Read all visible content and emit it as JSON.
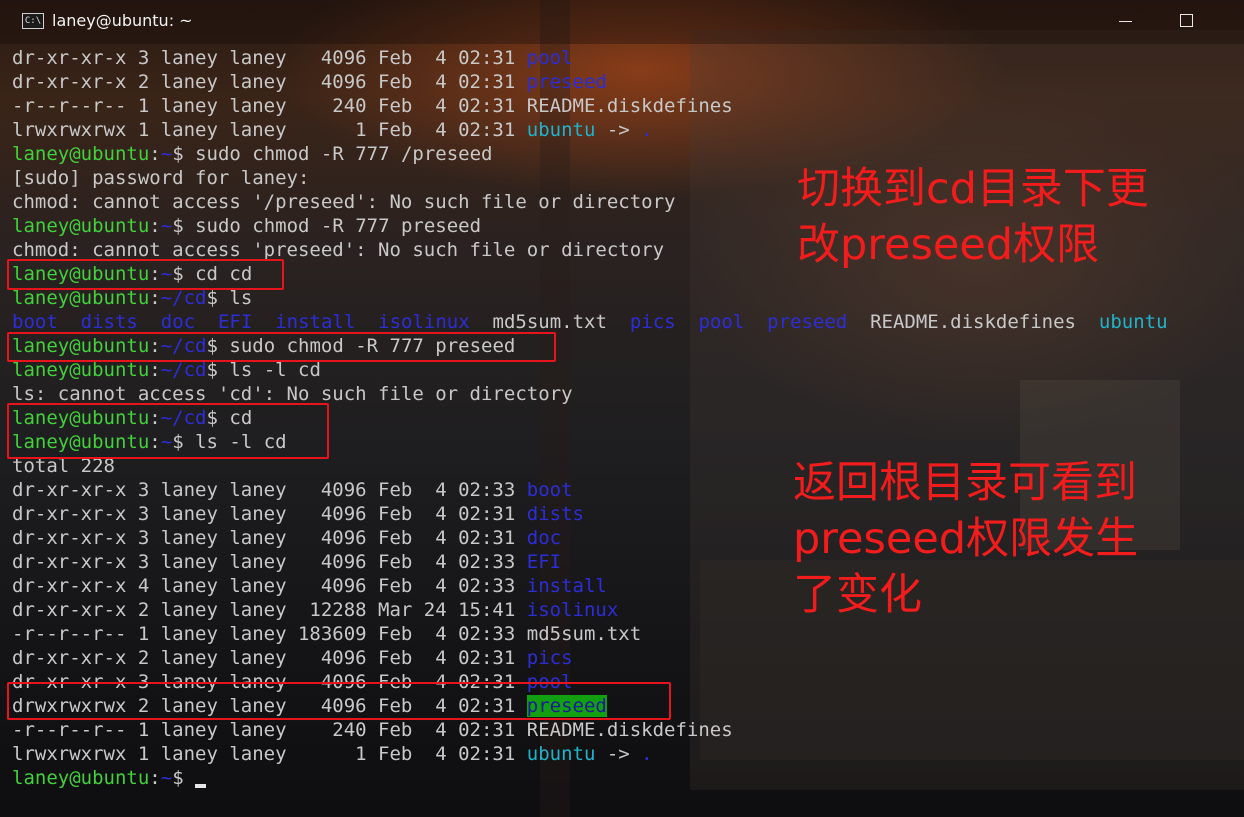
{
  "window": {
    "title": "laney@ubuntu: ~",
    "icon": "C:\\",
    "controls": [
      "minimize-icon",
      "maximize-icon"
    ]
  },
  "colors": {
    "prompt": "#41d13a",
    "directory": "#2d2dd8",
    "symlink": "#20b3cc",
    "highlight_bg": "#13a010",
    "annotation": "#f31c1c"
  },
  "terminal": {
    "lines": [
      {
        "name": "line-ls-pool",
        "segs": [
          [
            "dr-xr-xr-x 3 laney laney   4096 Feb  4 02:31 ",
            "c-gray"
          ],
          [
            "pool",
            "c-blue"
          ]
        ]
      },
      {
        "name": "line-ls-preseed",
        "segs": [
          [
            "dr-xr-xr-x 2 laney laney   4096 Feb  4 02:31 ",
            "c-gray"
          ],
          [
            "preseed",
            "c-blue"
          ]
        ]
      },
      {
        "name": "line-ls-readme",
        "segs": [
          [
            "-r--r--r-- 1 laney laney    240 Feb  4 02:31 README.diskdefines",
            "c-gray"
          ]
        ]
      },
      {
        "name": "line-ls-ubuntu",
        "segs": [
          [
            "lrwxrwxrwx 1 laney laney      1 Feb  4 02:31 ",
            "c-gray"
          ],
          [
            "ubuntu",
            "c-cyan"
          ],
          [
            " -> ",
            "c-gray"
          ],
          [
            ".",
            "c-blue"
          ]
        ]
      },
      {
        "name": "line-cmd-chmod-root",
        "segs": [
          [
            "laney@ubuntu",
            "c-green"
          ],
          [
            ":",
            "c-gray"
          ],
          [
            "~",
            "c-blue"
          ],
          [
            "$ sudo chmod -R 777 /preseed",
            "c-gray"
          ]
        ]
      },
      {
        "name": "line-sudo-password",
        "segs": [
          [
            "[sudo] password for laney:",
            "c-gray"
          ]
        ]
      },
      {
        "name": "line-error-root",
        "segs": [
          [
            "chmod: cannot access '/preseed': No such file or directory",
            "c-gray"
          ]
        ]
      },
      {
        "name": "line-cmd-chmod-rel",
        "segs": [
          [
            "laney@ubuntu",
            "c-green"
          ],
          [
            ":",
            "c-gray"
          ],
          [
            "~",
            "c-blue"
          ],
          [
            "$ sudo chmod -R 777 preseed",
            "c-gray"
          ]
        ]
      },
      {
        "name": "line-error-rel",
        "segs": [
          [
            "chmod: cannot access 'preseed': No such file or directory",
            "c-gray"
          ]
        ]
      },
      {
        "name": "line-cmd-cd",
        "segs": [
          [
            "laney@ubuntu",
            "c-green"
          ],
          [
            ":",
            "c-gray"
          ],
          [
            "~",
            "c-blue"
          ],
          [
            "$ cd cd",
            "c-gray"
          ]
        ]
      },
      {
        "name": "line-cmd-ls",
        "segs": [
          [
            "laney@ubuntu",
            "c-green"
          ],
          [
            ":",
            "c-gray"
          ],
          [
            "~/cd",
            "c-blue"
          ],
          [
            "$ ls",
            "c-gray"
          ]
        ]
      },
      {
        "name": "line-ls-short",
        "segs": [
          [
            "boot",
            "c-blue"
          ],
          [
            "  ",
            "c-gray"
          ],
          [
            "dists",
            "c-blue"
          ],
          [
            "  ",
            "c-gray"
          ],
          [
            "doc",
            "c-blue"
          ],
          [
            "  ",
            "c-gray"
          ],
          [
            "EFI",
            "c-blue"
          ],
          [
            "  ",
            "c-gray"
          ],
          [
            "install",
            "c-blue"
          ],
          [
            "  ",
            "c-gray"
          ],
          [
            "isolinux",
            "c-blue"
          ],
          [
            "  md5sum.txt  ",
            "c-gray"
          ],
          [
            "pics",
            "c-blue"
          ],
          [
            "  ",
            "c-gray"
          ],
          [
            "pool",
            "c-blue"
          ],
          [
            "  ",
            "c-gray"
          ],
          [
            "preseed",
            "c-blue"
          ],
          [
            "  README.diskdefines  ",
            "c-gray"
          ],
          [
            "ubuntu",
            "c-cyan"
          ]
        ]
      },
      {
        "name": "line-cmd-chmod-cd",
        "segs": [
          [
            "laney@ubuntu",
            "c-green"
          ],
          [
            ":",
            "c-gray"
          ],
          [
            "~/cd",
            "c-blue"
          ],
          [
            "$ sudo chmod -R 777 preseed",
            "c-gray"
          ]
        ]
      },
      {
        "name": "line-cmd-ls-l-cd",
        "segs": [
          [
            "laney@ubuntu",
            "c-green"
          ],
          [
            ":",
            "c-gray"
          ],
          [
            "~/cd",
            "c-blue"
          ],
          [
            "$ ls -l cd",
            "c-gray"
          ]
        ]
      },
      {
        "name": "line-error-ls",
        "segs": [
          [
            "ls: cannot access 'cd': No such file or directory",
            "c-gray"
          ]
        ]
      },
      {
        "name": "line-cmd-cd-home",
        "segs": [
          [
            "laney@ubuntu",
            "c-green"
          ],
          [
            ":",
            "c-gray"
          ],
          [
            "~/cd",
            "c-blue"
          ],
          [
            "$ cd",
            "c-gray"
          ]
        ]
      },
      {
        "name": "line-cmd-ls-l-cd-2",
        "segs": [
          [
            "laney@ubuntu",
            "c-green"
          ],
          [
            ":",
            "c-gray"
          ],
          [
            "~",
            "c-blue"
          ],
          [
            "$ ls -l cd",
            "c-gray"
          ]
        ]
      },
      {
        "name": "line-total",
        "segs": [
          [
            "total 228",
            "c-gray"
          ]
        ]
      },
      {
        "name": "line-ls2-boot",
        "segs": [
          [
            "dr-xr-xr-x 3 laney laney   4096 Feb  4 02:33 ",
            "c-gray"
          ],
          [
            "boot",
            "c-blue"
          ]
        ]
      },
      {
        "name": "line-ls2-dists",
        "segs": [
          [
            "dr-xr-xr-x 3 laney laney   4096 Feb  4 02:31 ",
            "c-gray"
          ],
          [
            "dists",
            "c-blue"
          ]
        ]
      },
      {
        "name": "line-ls2-doc",
        "segs": [
          [
            "dr-xr-xr-x 3 laney laney   4096 Feb  4 02:31 ",
            "c-gray"
          ],
          [
            "doc",
            "c-blue"
          ]
        ]
      },
      {
        "name": "line-ls2-efi",
        "segs": [
          [
            "dr-xr-xr-x 3 laney laney   4096 Feb  4 02:33 ",
            "c-gray"
          ],
          [
            "EFI",
            "c-blue"
          ]
        ]
      },
      {
        "name": "line-ls2-install",
        "segs": [
          [
            "dr-xr-xr-x 4 laney laney   4096 Feb  4 02:33 ",
            "c-gray"
          ],
          [
            "install",
            "c-blue"
          ]
        ]
      },
      {
        "name": "line-ls2-isolinux",
        "segs": [
          [
            "dr-xr-xr-x 2 laney laney  12288 Mar 24 15:41 ",
            "c-gray"
          ],
          [
            "isolinux",
            "c-blue"
          ]
        ]
      },
      {
        "name": "line-ls2-md5sum",
        "segs": [
          [
            "-r--r--r-- 1 laney laney 183609 Feb  4 02:33 md5sum.txt",
            "c-gray"
          ]
        ]
      },
      {
        "name": "line-ls2-pics",
        "segs": [
          [
            "dr-xr-xr-x 2 laney laney   4096 Feb  4 02:31 ",
            "c-gray"
          ],
          [
            "pics",
            "c-blue"
          ]
        ]
      },
      {
        "name": "line-ls2-pool",
        "segs": [
          [
            "dr-xr-xr-x 3 laney laney   4096 Feb  4 02:31 ",
            "c-gray"
          ],
          [
            "pool",
            "c-blue"
          ]
        ]
      },
      {
        "name": "line-ls2-preseed",
        "segs": [
          [
            "drwxrwxrwx 2 laney laney   4096 Feb  4 02:31 ",
            "c-gray"
          ],
          [
            "preseed",
            "hl"
          ]
        ]
      },
      {
        "name": "line-ls2-readme",
        "segs": [
          [
            "-r--r--r-- 1 laney laney    240 Feb  4 02:31 README.diskdefines",
            "c-gray"
          ]
        ]
      },
      {
        "name": "line-ls2-ubuntu",
        "segs": [
          [
            "lrwxrwxrwx 1 laney laney      1 Feb  4 02:31 ",
            "c-gray"
          ],
          [
            "ubuntu",
            "c-cyan"
          ],
          [
            " -> ",
            "c-gray"
          ],
          [
            ".",
            "c-blue"
          ]
        ]
      },
      {
        "name": "line-final-prompt",
        "segs": [
          [
            "laney@ubuntu",
            "c-green"
          ],
          [
            ":",
            "c-gray"
          ],
          [
            "~",
            "c-blue"
          ],
          [
            "$ ",
            "c-gray"
          ]
        ],
        "cursor": true
      }
    ]
  },
  "annotations": {
    "note_top": "切换到cd目录下更\n改preseed权限",
    "note_bottom": "返回根目录可看到\npreseed权限发生\n了变化"
  }
}
